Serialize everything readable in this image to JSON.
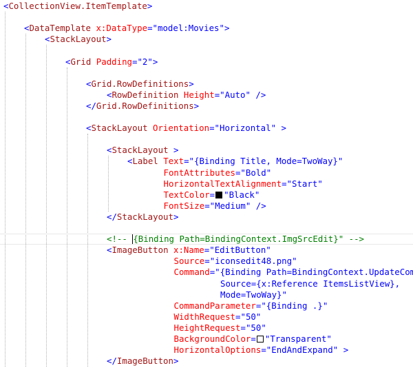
{
  "colors": {
    "punct": "#0000ff",
    "element": "#a31515",
    "attribute": "#ff0000",
    "value": "#0000ff",
    "comment": "#008000",
    "text": "#000000"
  },
  "editor": {
    "lines": [
      {
        "indent": 0,
        "tokens": [
          [
            "punct",
            "<"
          ],
          [
            "element",
            "CollectionView.ItemTemplate"
          ],
          [
            "punct",
            ">"
          ]
        ]
      },
      {
        "indent": 0,
        "tokens": []
      },
      {
        "indent": 4,
        "tokens": [
          [
            "punct",
            "<"
          ],
          [
            "element",
            "DataTemplate"
          ],
          [
            "text",
            " "
          ],
          [
            "attribute",
            "x:DataType"
          ],
          [
            "punct",
            "=\""
          ],
          [
            "value",
            "model:Movies"
          ],
          [
            "punct",
            "\">"
          ]
        ]
      },
      {
        "indent": 8,
        "tokens": [
          [
            "punct",
            "<"
          ],
          [
            "element",
            "StackLayout"
          ],
          [
            "punct",
            ">"
          ]
        ]
      },
      {
        "indent": 0,
        "tokens": []
      },
      {
        "indent": 12,
        "tokens": [
          [
            "punct",
            "<"
          ],
          [
            "element",
            "Grid"
          ],
          [
            "text",
            " "
          ],
          [
            "attribute",
            "Padding"
          ],
          [
            "punct",
            "=\""
          ],
          [
            "value",
            "2"
          ],
          [
            "punct",
            "\">"
          ]
        ]
      },
      {
        "indent": 0,
        "tokens": []
      },
      {
        "indent": 16,
        "tokens": [
          [
            "punct",
            "<"
          ],
          [
            "element",
            "Grid.RowDefinitions"
          ],
          [
            "punct",
            ">"
          ]
        ]
      },
      {
        "indent": 20,
        "tokens": [
          [
            "punct",
            "<"
          ],
          [
            "element",
            "RowDefinition"
          ],
          [
            "text",
            " "
          ],
          [
            "attribute",
            "Height"
          ],
          [
            "punct",
            "=\""
          ],
          [
            "value",
            "Auto"
          ],
          [
            "punct",
            "\" />"
          ]
        ]
      },
      {
        "indent": 16,
        "tokens": [
          [
            "punct",
            "</"
          ],
          [
            "element",
            "Grid.RowDefinitions"
          ],
          [
            "punct",
            ">"
          ]
        ]
      },
      {
        "indent": 0,
        "tokens": []
      },
      {
        "indent": 16,
        "tokens": [
          [
            "punct",
            "<"
          ],
          [
            "element",
            "StackLayout"
          ],
          [
            "text",
            " "
          ],
          [
            "attribute",
            "Orientation"
          ],
          [
            "punct",
            "=\""
          ],
          [
            "value",
            "Horizontal"
          ],
          [
            "punct",
            "\" >"
          ]
        ]
      },
      {
        "indent": 0,
        "tokens": []
      },
      {
        "indent": 20,
        "tokens": [
          [
            "punct",
            "<"
          ],
          [
            "element",
            "StackLayout"
          ],
          [
            "punct",
            " >"
          ]
        ]
      },
      {
        "indent": 24,
        "tokens": [
          [
            "punct",
            "<"
          ],
          [
            "element",
            "Label"
          ],
          [
            "text",
            " "
          ],
          [
            "attribute",
            "Text"
          ],
          [
            "punct",
            "=\""
          ],
          [
            "value",
            "{Binding Title, Mode=TwoWay}"
          ],
          [
            "punct",
            "\""
          ]
        ]
      },
      {
        "indent": 31,
        "tokens": [
          [
            "attribute",
            "FontAttributes"
          ],
          [
            "punct",
            "=\""
          ],
          [
            "value",
            "Bold"
          ],
          [
            "punct",
            "\""
          ]
        ]
      },
      {
        "indent": 31,
        "tokens": [
          [
            "attribute",
            "HorizontalTextAlignment"
          ],
          [
            "punct",
            "=\""
          ],
          [
            "value",
            "Start"
          ],
          [
            "punct",
            "\""
          ]
        ]
      },
      {
        "indent": 31,
        "tokens": [
          [
            "attribute",
            "TextColor"
          ],
          [
            "punct",
            "="
          ],
          [
            "swatch",
            "#000000"
          ],
          [
            "punct",
            "\""
          ],
          [
            "value",
            "Black"
          ],
          [
            "punct",
            "\""
          ]
        ]
      },
      {
        "indent": 31,
        "tokens": [
          [
            "attribute",
            "FontSize"
          ],
          [
            "punct",
            "=\""
          ],
          [
            "value",
            "Medium"
          ],
          [
            "punct",
            "\" />"
          ]
        ]
      },
      {
        "indent": 20,
        "tokens": [
          [
            "punct",
            "</"
          ],
          [
            "element",
            "StackLayout"
          ],
          [
            "punct",
            ">"
          ]
        ]
      },
      {
        "indent": 0,
        "tokens": []
      },
      {
        "indent": 20,
        "current": true,
        "tokens": [
          [
            "comment",
            "<!-- "
          ],
          [
            "caret",
            ""
          ],
          [
            "comment",
            "{Binding Path=BindingContext.ImgSrcEdit}\" -->"
          ]
        ]
      },
      {
        "indent": 20,
        "tokens": [
          [
            "punct",
            "<"
          ],
          [
            "element",
            "ImageButton"
          ],
          [
            "text",
            " "
          ],
          [
            "attribute",
            "x:Name"
          ],
          [
            "punct",
            "=\""
          ],
          [
            "value",
            "EditButton"
          ],
          [
            "punct",
            "\""
          ]
        ]
      },
      {
        "indent": 33,
        "tokens": [
          [
            "attribute",
            "Source"
          ],
          [
            "punct",
            "=\""
          ],
          [
            "value",
            "iconsedit48.png"
          ],
          [
            "punct",
            "\""
          ]
        ]
      },
      {
        "indent": 33,
        "tokens": [
          [
            "attribute",
            "Command"
          ],
          [
            "punct",
            "=\""
          ],
          [
            "value",
            "{Binding Path=BindingContext.UpdateCommand,"
          ]
        ]
      },
      {
        "indent": 42,
        "tokens": [
          [
            "value",
            "Source={x:Reference ItemsListView},"
          ]
        ]
      },
      {
        "indent": 42,
        "tokens": [
          [
            "value",
            "Mode=TwoWay}"
          ],
          [
            "punct",
            "\""
          ]
        ]
      },
      {
        "indent": 33,
        "tokens": [
          [
            "attribute",
            "CommandParameter"
          ],
          [
            "punct",
            "=\""
          ],
          [
            "value",
            "{Binding .}"
          ],
          [
            "punct",
            "\""
          ]
        ]
      },
      {
        "indent": 33,
        "tokens": [
          [
            "attribute",
            "WidthRequest"
          ],
          [
            "punct",
            "=\""
          ],
          [
            "value",
            "50"
          ],
          [
            "punct",
            "\""
          ]
        ]
      },
      {
        "indent": 33,
        "tokens": [
          [
            "attribute",
            "HeightRequest"
          ],
          [
            "punct",
            "=\""
          ],
          [
            "value",
            "50"
          ],
          [
            "punct",
            "\""
          ]
        ]
      },
      {
        "indent": 33,
        "tokens": [
          [
            "attribute",
            "BackgroundColor"
          ],
          [
            "punct",
            "="
          ],
          [
            "swatch",
            "#ffffff"
          ],
          [
            "punct",
            "\""
          ],
          [
            "value",
            "Transparent"
          ],
          [
            "punct",
            "\""
          ]
        ]
      },
      {
        "indent": 33,
        "tokens": [
          [
            "attribute",
            "HorizontalOptions"
          ],
          [
            "punct",
            "=\""
          ],
          [
            "value",
            "EndAndExpand"
          ],
          [
            "punct",
            "\" >"
          ]
        ]
      },
      {
        "indent": 20,
        "tokens": [
          [
            "punct",
            "</"
          ],
          [
            "element",
            "ImageButton"
          ],
          [
            "punct",
            ">"
          ]
        ]
      }
    ]
  }
}
